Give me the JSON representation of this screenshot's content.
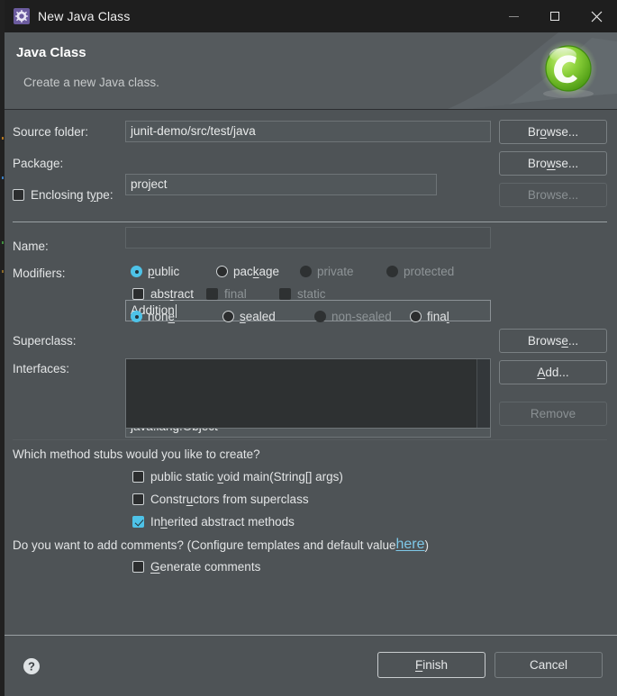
{
  "window": {
    "title": "New Java Class",
    "icon": "gear-icon",
    "controls": {
      "minimize": "minimize-icon",
      "maximize": "maximize-icon",
      "close": "close-icon"
    }
  },
  "banner": {
    "title": "Java Class",
    "description": "Create a new Java class.",
    "logo": "java-class-wizard-icon",
    "background": "#555a5d"
  },
  "form": {
    "source_folder": {
      "label": "Source folder:",
      "value": "junit-demo/src/test/java",
      "browse": "Browse...",
      "browse_mnemonic": "o"
    },
    "package": {
      "label": "Package:",
      "value": "project",
      "placeholder": "",
      "browse": "Browse...",
      "browse_mnemonic": "w"
    },
    "enclosing_type": {
      "label": "Enclosing type:",
      "checked": false,
      "value": "",
      "placeholder": "",
      "browse": "Browse...",
      "enabled": false
    },
    "name": {
      "label": "Name:",
      "value": "Addition",
      "focused": true
    },
    "modifiers": {
      "label": "Modifiers:",
      "access": [
        {
          "label": "public",
          "mnemonic": "p",
          "selected": true,
          "enabled": true
        },
        {
          "label": "package",
          "mnemonic": "k",
          "selected": false,
          "enabled": true
        },
        {
          "label": "private",
          "mnemonic": "v",
          "selected": false,
          "enabled": false
        },
        {
          "label": "protected",
          "mnemonic": "t",
          "selected": false,
          "enabled": false
        }
      ],
      "flags": [
        {
          "label": "abstract",
          "mnemonic": "t",
          "checked": false,
          "enabled": true
        },
        {
          "label": "final",
          "mnemonic": "l",
          "checked": false,
          "enabled": false
        },
        {
          "label": "static",
          "mnemonic": "c",
          "checked": false,
          "enabled": false
        }
      ],
      "sealed": [
        {
          "label": "none",
          "mnemonic": "e",
          "selected": true,
          "enabled": true
        },
        {
          "label": "sealed",
          "mnemonic": "s",
          "selected": false,
          "enabled": true
        },
        {
          "label": "non-sealed",
          "mnemonic": "n",
          "selected": false,
          "enabled": false
        },
        {
          "label": "final",
          "mnemonic": "l",
          "selected": false,
          "enabled": true
        }
      ]
    },
    "superclass": {
      "label": "Superclass:",
      "value": "java.lang.Object",
      "browse": "Browse...",
      "browse_mnemonic": "e"
    },
    "interfaces": {
      "label": "Interfaces:",
      "items": [],
      "add": "Add...",
      "add_mnemonic": "A",
      "remove": "Remove",
      "remove_enabled": false
    }
  },
  "stubs": {
    "question": "Which method stubs would you like to create?",
    "options": [
      {
        "label": "public static void main(String[] args)",
        "checked": false
      },
      {
        "label": "Constructors from superclass",
        "checked": false
      },
      {
        "label": "Inherited abstract methods",
        "checked": true
      }
    ]
  },
  "comments": {
    "question_prefix": "Do you want to add comments? (Configure templates and default value ",
    "link": "here",
    "question_suffix": ")",
    "option": {
      "label": "Generate comments",
      "checked": false
    }
  },
  "footer": {
    "help": "help-icon",
    "finish": "Finish",
    "finish_mnemonic": "F",
    "cancel": "Cancel",
    "default_button": "Finish"
  },
  "colors": {
    "dialog_bg": "#4e5356",
    "titlebar_bg": "#1e1e1e",
    "accent": "#4ec3e8",
    "link": "#7ec8e8",
    "text": "#e3e5e6",
    "text_disabled": "#8e9497",
    "field_bg": "#51575a",
    "list_bg": "#2e3132"
  }
}
